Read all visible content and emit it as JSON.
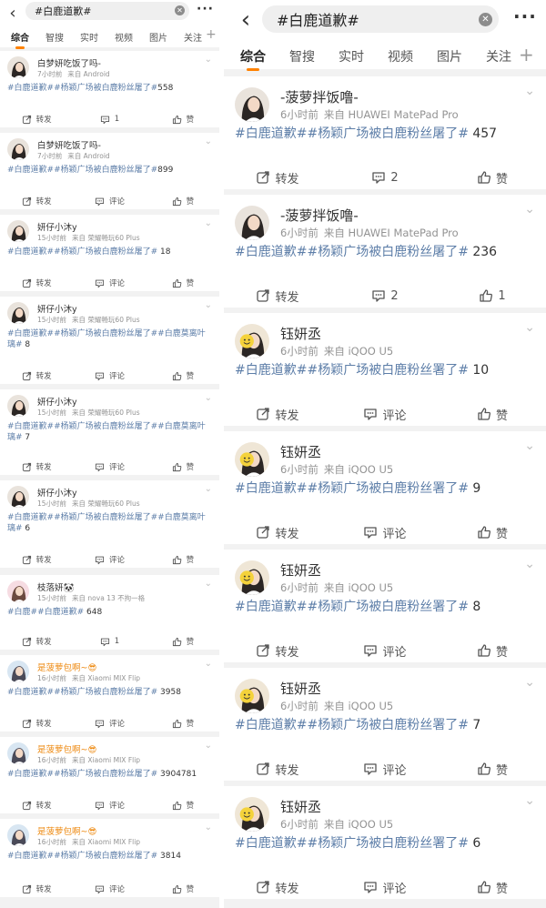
{
  "left": {
    "search_query": "#白鹿道歉#",
    "tabs": [
      "综合",
      "智搜",
      "实时",
      "视频",
      "图片",
      "关注"
    ],
    "posts": [
      {
        "user": "白梦妍吃饭了吗-",
        "time": "7小时前",
        "source": "来自 Android",
        "segments": [
          {
            "t": "#白鹿道歉##杨颖广场被白鹿粉丝屠了#",
            "tag": true
          },
          {
            "t": "558",
            "tag": false
          }
        ],
        "repost": "转发",
        "comment": "1",
        "like": "赞",
        "avatar": "girl-dark"
      },
      {
        "user": "白梦妍吃饭了吗-",
        "time": "7小时前",
        "source": "来自 Android",
        "segments": [
          {
            "t": "#白鹿道歉##杨颖广场被白鹿粉丝屠了#",
            "tag": true
          },
          {
            "t": "899",
            "tag": false
          }
        ],
        "repost": "转发",
        "comment": "评论",
        "like": "赞",
        "avatar": "girl-dark"
      },
      {
        "user": "妍仔小沐y",
        "time": "15小时前",
        "source": "来自 荣耀畅玩60 Plus",
        "segments": [
          {
            "t": "#白鹿道歉##杨颖广场被白鹿粉丝屠了#",
            "tag": true
          },
          {
            "t": " 18",
            "tag": false
          }
        ],
        "repost": "转发",
        "comment": "评论",
        "like": "赞",
        "avatar": "girl-dark"
      },
      {
        "user": "妍仔小沐y",
        "time": "15小时前",
        "source": "来自 荣耀畅玩60 Plus",
        "segments": [
          {
            "t": "#白鹿道歉##杨颖广场被白鹿粉丝屠了##白鹿莫离叶璃#",
            "tag": true
          },
          {
            "t": " 8",
            "tag": false
          }
        ],
        "repost": "转发",
        "comment": "评论",
        "like": "赞",
        "avatar": "girl-dark"
      },
      {
        "user": "妍仔小沐y",
        "time": "15小时前",
        "source": "来自 荣耀畅玩60 Plus",
        "segments": [
          {
            "t": "#白鹿道歉##杨颖广场被白鹿粉丝屠了##白鹿莫离叶璃#",
            "tag": true
          },
          {
            "t": " 7",
            "tag": false
          }
        ],
        "repost": "转发",
        "comment": "评论",
        "like": "赞",
        "avatar": "girl-dark"
      },
      {
        "user": "妍仔小沐y",
        "time": "15小时前",
        "source": "来自 荣耀畅玩60 Plus",
        "segments": [
          {
            "t": "#白鹿道歉##杨颖广场被白鹿粉丝屠了##白鹿莫离叶璃#",
            "tag": true
          },
          {
            "t": " 6",
            "tag": false
          }
        ],
        "repost": "转发",
        "comment": "评论",
        "like": "赞",
        "avatar": "girl-dark"
      },
      {
        "user": "枝落妍🐼",
        "time": "15小时前",
        "source": "来自 nova 13 不拘一格",
        "segments": [
          {
            "t": "#白鹿##白鹿道歉#",
            "tag": true
          },
          {
            "t": " 648",
            "tag": false
          }
        ],
        "repost": "转发",
        "comment": "1",
        "like": "赞",
        "avatar": "girl-pink"
      },
      {
        "user": "是菠萝包啊~😎",
        "time": "16小时前",
        "source": "来自 Xiaomi MIX Flip",
        "segments": [
          {
            "t": "#白鹿道歉##杨颖广场被白鹿粉丝屠了#",
            "tag": true
          },
          {
            "t": " 3958",
            "tag": false
          }
        ],
        "repost": "转发",
        "comment": "评论",
        "like": "赞",
        "avatar": "girl-blue",
        "orange": true
      },
      {
        "user": "是菠萝包啊~😎",
        "time": "16小时前",
        "source": "来自 Xiaomi MIX Flip",
        "segments": [
          {
            "t": "#白鹿道歉##杨颖广场被白鹿粉丝屠了#",
            "tag": true
          },
          {
            "t": " 3904781",
            "tag": false
          }
        ],
        "repost": "转发",
        "comment": "评论",
        "like": "赞",
        "avatar": "girl-blue",
        "orange": true
      },
      {
        "user": "是菠萝包啊~😎",
        "time": "16小时前",
        "source": "来自 Xiaomi MIX Flip",
        "segments": [
          {
            "t": "#白鹿道歉##杨颖广场被白鹿粉丝屠了#",
            "tag": true
          },
          {
            "t": " 3814",
            "tag": false
          }
        ],
        "repost": "转发",
        "comment": "评论",
        "like": "赞",
        "avatar": "girl-blue",
        "orange": true
      }
    ]
  },
  "right": {
    "search_query": "#白鹿道歉#",
    "tabs": [
      "综合",
      "智搜",
      "实时",
      "视频",
      "图片",
      "关注"
    ],
    "posts": [
      {
        "user": "-菠萝拌饭噜-",
        "time": "6小时前",
        "source": "来自 HUAWEI MatePad Pro",
        "segments": [
          {
            "t": "#白鹿道歉##杨颖广场被白鹿粉丝屠了#",
            "tag": true
          },
          {
            "t": " 457",
            "tag": false
          }
        ],
        "repost": "转发",
        "comment": "2",
        "like": "赞",
        "avatar": "girl-dark"
      },
      {
        "user": "-菠萝拌饭噜-",
        "time": "6小时前",
        "source": "来自 HUAWEI MatePad Pro",
        "segments": [
          {
            "t": "#白鹿道歉##杨颖广场被白鹿粉丝屠了#",
            "tag": true
          },
          {
            "t": " 236",
            "tag": false
          }
        ],
        "repost": "转发",
        "comment": "2",
        "like": "1",
        "avatar": "girl-dark"
      },
      {
        "user": "钰妍丞",
        "time": "6小时前",
        "source": "来自 iQOO U5",
        "segments": [
          {
            "t": "#白鹿道歉##杨颖广场被白鹿粉丝署了#",
            "tag": true
          },
          {
            "t": " 10",
            "tag": false
          }
        ],
        "repost": "转发",
        "comment": "评论",
        "like": "赞",
        "avatar": "girl-smiley"
      },
      {
        "user": "钰妍丞",
        "time": "6小时前",
        "source": "来自 iQOO U5",
        "segments": [
          {
            "t": "#白鹿道歉##杨颖广场被白鹿粉丝署了#",
            "tag": true
          },
          {
            "t": " 9",
            "tag": false
          }
        ],
        "repost": "转发",
        "comment": "评论",
        "like": "赞",
        "avatar": "girl-smiley"
      },
      {
        "user": "钰妍丞",
        "time": "6小时前",
        "source": "来自 iQOO U5",
        "segments": [
          {
            "t": "#白鹿道歉##杨颖广场被白鹿粉丝署了#",
            "tag": true
          },
          {
            "t": " 8",
            "tag": false
          }
        ],
        "repost": "转发",
        "comment": "评论",
        "like": "赞",
        "avatar": "girl-smiley"
      },
      {
        "user": "钰妍丞",
        "time": "6小时前",
        "source": "来自 iQOO U5",
        "segments": [
          {
            "t": "#白鹿道歉##杨颖广场被白鹿粉丝署了#",
            "tag": true
          },
          {
            "t": " 7",
            "tag": false
          }
        ],
        "repost": "转发",
        "comment": "评论",
        "like": "赞",
        "avatar": "girl-smiley"
      },
      {
        "user": "钰妍丞",
        "time": "6小时前",
        "source": "来自 iQOO U5",
        "segments": [
          {
            "t": "#白鹿道歉##杨颖广场被白鹿粉丝署了#",
            "tag": true
          },
          {
            "t": " 6",
            "tag": false
          }
        ],
        "repost": "转发",
        "comment": "评论",
        "like": "赞",
        "avatar": "girl-smiley"
      }
    ]
  },
  "colors": {
    "accent": "#ff8200",
    "hashtag": "#5d7ea8",
    "meta": "#939393",
    "orange_name": "#ee8b14"
  }
}
